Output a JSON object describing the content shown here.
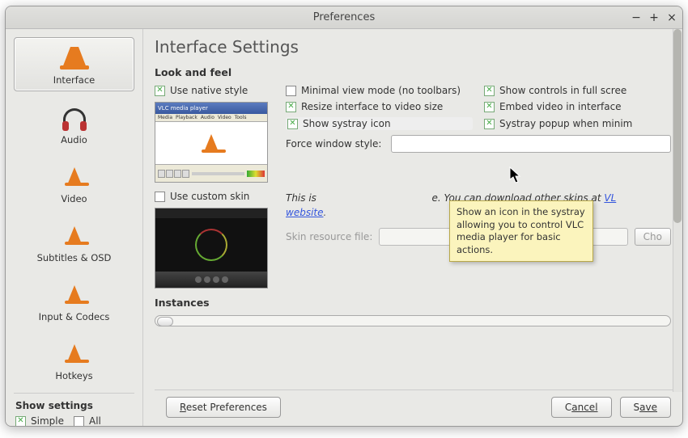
{
  "window": {
    "title": "Preferences"
  },
  "sidebar": {
    "items": [
      {
        "label": "Interface"
      },
      {
        "label": "Audio"
      },
      {
        "label": "Video"
      },
      {
        "label": "Subtitles & OSD"
      },
      {
        "label": "Input & Codecs"
      },
      {
        "label": "Hotkeys"
      }
    ]
  },
  "show_settings": {
    "heading": "Show settings",
    "simple": "Simple",
    "all": "All"
  },
  "page": {
    "heading": "Interface Settings",
    "look_and_feel": {
      "title": "Look and feel",
      "use_native": "Use native style",
      "minimal_view": "Minimal view mode (no toolbars)",
      "show_controls": "Show controls in full scree",
      "resize_interface": "Resize interface to video size",
      "embed_video": "Embed video in interface",
      "show_systray": "Show systray icon",
      "systray_popup": "Systray popup when minim",
      "force_window_label": "Force window style:",
      "use_custom_skin": "Use custom skin",
      "skin_note_a": "This is",
      "skin_note_b": "e. You can download other skins at ",
      "skin_link": "VLC skins website",
      "skin_link_short": "VL",
      "skin_website_word": "website",
      "skin_resource_label": "Skin resource file:",
      "choose_btn": "Cho"
    },
    "instances": {
      "title": "Instances"
    },
    "preview": {
      "title": "VLC media player",
      "menus": [
        "Media",
        "Playback",
        "Audio",
        "Video",
        "Tools"
      ]
    }
  },
  "tooltip": {
    "text": "Show an icon in the systray allowing you to control VLC media player for basic actions."
  },
  "footer": {
    "reset": "Reset Preferences",
    "cancel_pre": "C",
    "cancel_ul": "ancel",
    "save_pre": "S",
    "save_ul": "ave"
  }
}
